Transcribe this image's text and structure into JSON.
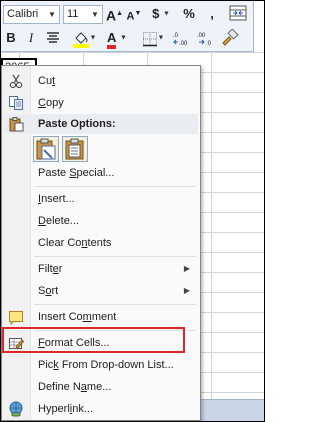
{
  "toolbar": {
    "font_name": "Calibri",
    "font_size": "11",
    "grow_font_label": "A",
    "shrink_font_label": "A",
    "currency_label": "$",
    "percent_label": "%",
    "comma_label": ",",
    "bold_label": "B",
    "italic_label": "I",
    "font_color_label": "A",
    "increase_decimal_label": ".0→.00",
    "decrease_decimal_label": ".00→.0"
  },
  "cell_ref_text": "2065",
  "menu": {
    "cut": {
      "pre": "Cu",
      "key": "t",
      "post": ""
    },
    "copy": {
      "pre": "",
      "key": "C",
      "post": "opy"
    },
    "paste_options": "Paste Options:",
    "paste_special": {
      "pre": "Paste ",
      "key": "S",
      "post": "pecial..."
    },
    "insert": {
      "pre": "",
      "key": "I",
      "post": "nsert..."
    },
    "delete": {
      "pre": "",
      "key": "D",
      "post": "elete..."
    },
    "clear_contents": {
      "pre": "Clear Co",
      "key": "n",
      "post": "tents"
    },
    "filter": {
      "pre": "Filt",
      "key": "e",
      "post": "r"
    },
    "sort": {
      "pre": "S",
      "key": "o",
      "post": "rt"
    },
    "insert_comment": {
      "pre": "Insert Co",
      "key": "m",
      "post": "ment"
    },
    "format_cells": {
      "pre": "",
      "key": "F",
      "post": "ormat Cells..."
    },
    "pick_dropdown": {
      "pre": "Pic",
      "key": "k",
      "post": " From Drop-down List..."
    },
    "define_name": {
      "pre": "Define N",
      "key": "a",
      "post": "me..."
    },
    "hyperlink": {
      "pre": "Hyperl",
      "key": "i",
      "post": "nk..."
    }
  },
  "icons": [
    "cut-icon",
    "copy-icon",
    "paste-icon",
    "paste-keep-formatting-icon",
    "paste-values-icon",
    "insert-comment-icon",
    "format-cells-icon",
    "hyperlink-icon",
    "submenu-arrow-icon"
  ],
  "colors": {
    "highlight_border": "#e0262c",
    "fill_color": "#ffff00",
    "font_color": "#e0262c"
  }
}
